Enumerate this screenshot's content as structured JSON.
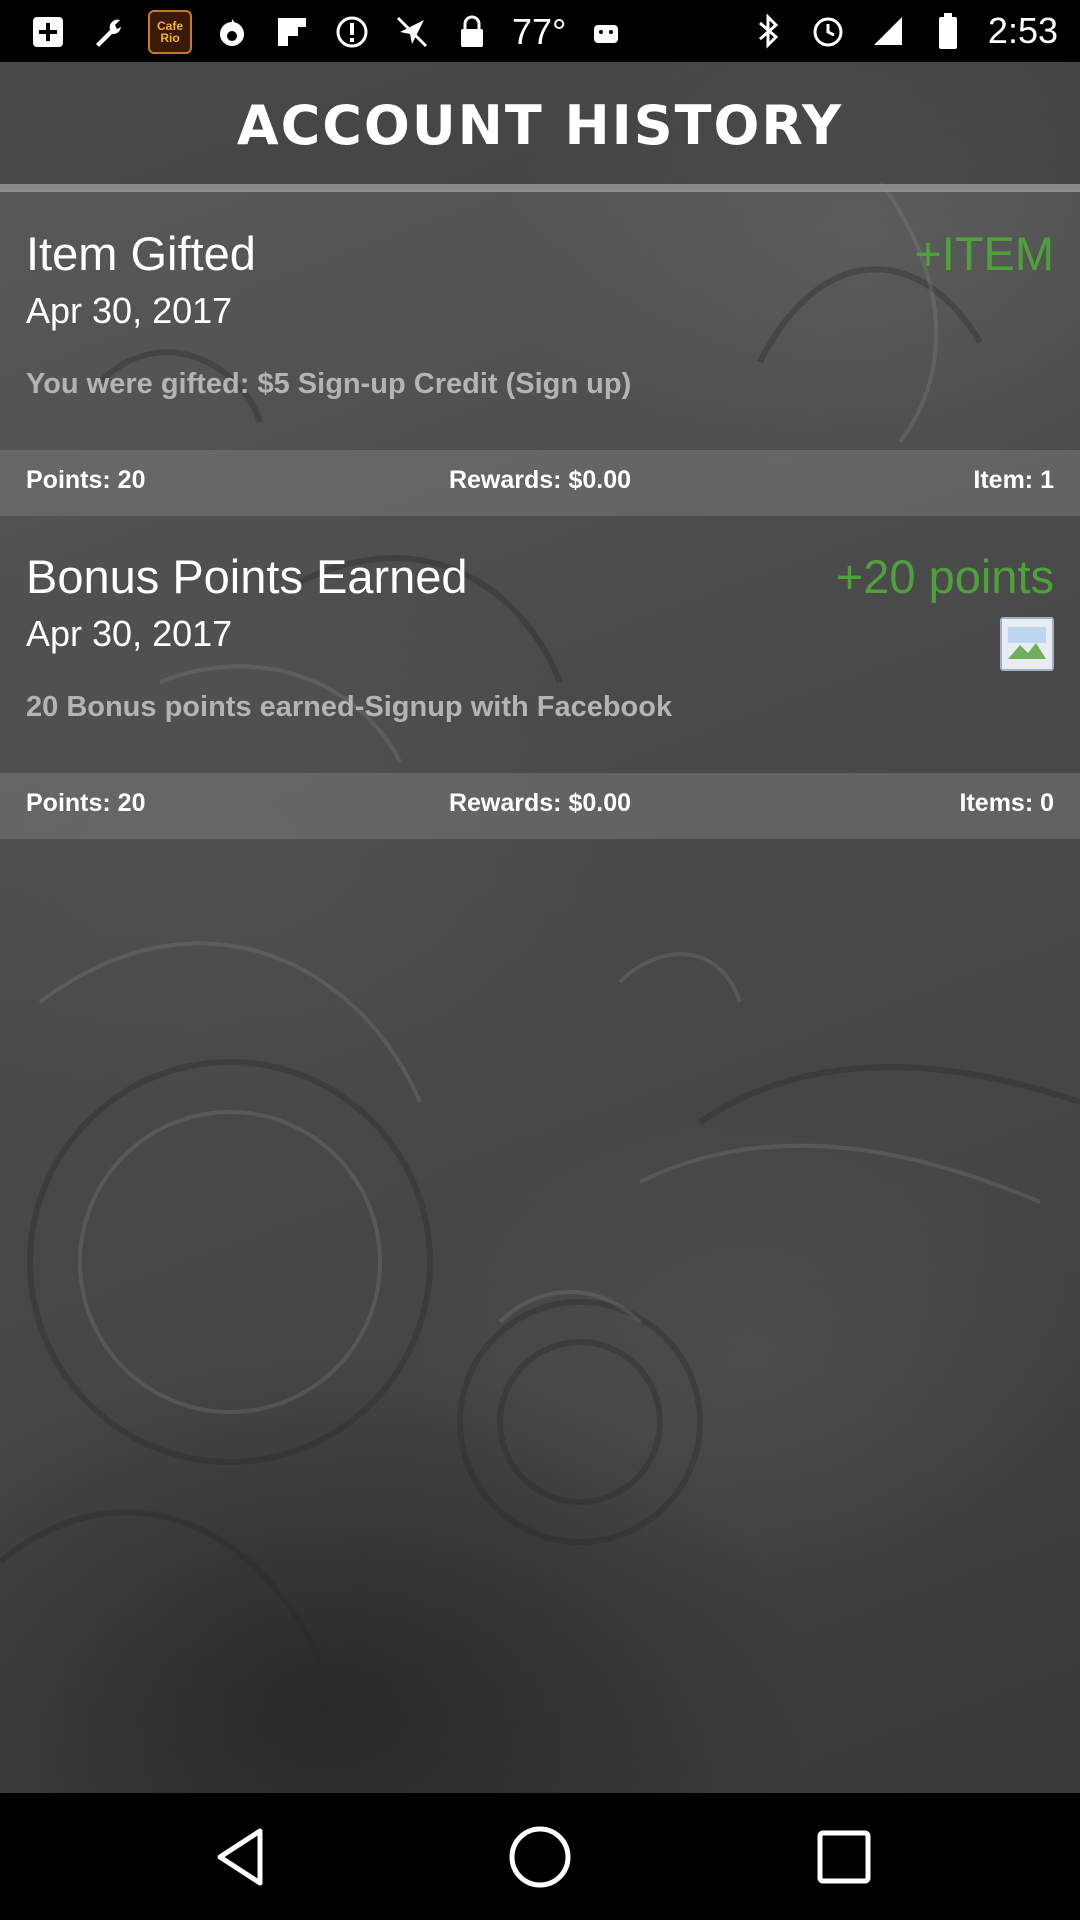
{
  "status_bar": {
    "left_icons": [
      "plus-box-icon",
      "wrench-icon",
      "app-icon",
      "fire-icon",
      "flipboard-icon",
      "info-icon",
      "no-location-icon",
      "lock-icon"
    ],
    "temperature": "77°",
    "right_icons": [
      "bluetooth-icon",
      "alarm-icon",
      "signal-icon",
      "battery-icon"
    ],
    "time": "2:53",
    "app_icon_text": "Cafe Rio"
  },
  "header": {
    "title": "ACCOUNT HISTORY"
  },
  "entries": [
    {
      "title": "Item Gifted",
      "tag": "+ITEM",
      "date": "Apr 30, 2017",
      "description": "You were gifted: $5 Sign-up Credit (Sign up)",
      "points": "Points: 20",
      "rewards": "Rewards: $0.00",
      "items": "Item: 1"
    },
    {
      "title": "Bonus Points Earned",
      "tag": "+20 points",
      "date": "Apr 30, 2017",
      "description": "20 Bonus points earned-Signup with Facebook",
      "points": "Points: 20",
      "rewards": "Rewards: $0.00",
      "items": "Items: 0"
    }
  ],
  "colors": {
    "accent_green": "#4fa13c",
    "background": "#4a4a4a",
    "summary_bar": "#787878"
  },
  "nav": [
    "back-icon",
    "home-icon",
    "recents-icon"
  ]
}
